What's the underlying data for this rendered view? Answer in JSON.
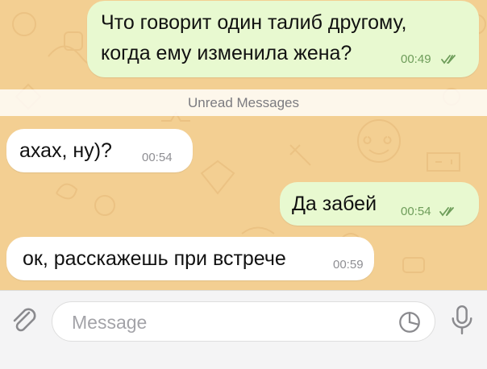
{
  "messages": [
    {
      "direction": "out",
      "lines": [
        "Что говорит один талиб другому,",
        "когда ему изменила жена?"
      ],
      "time": "00:49",
      "status": "read"
    },
    {
      "direction": "in",
      "text": "ахах, ну)?",
      "time": "00:54"
    },
    {
      "direction": "out",
      "text": "Да забей",
      "time": "00:54",
      "status": "read"
    },
    {
      "direction": "in",
      "text": "ок, расскажешь при встрече",
      "time": "00:59"
    }
  ],
  "unread_divider": "Unread Messages",
  "input": {
    "placeholder": "Message",
    "value": ""
  },
  "icons": {
    "attach": "paperclip-icon",
    "sticker": "sticker-icon",
    "mic": "microphone-icon",
    "read_status": "double-check-icon"
  },
  "colors": {
    "wallpaper": "#f3cf92",
    "outgoing_bubble": "#e8f9d0",
    "incoming_bubble": "#ffffff",
    "check": "#6e9d5a",
    "accent": "#3478f6"
  }
}
